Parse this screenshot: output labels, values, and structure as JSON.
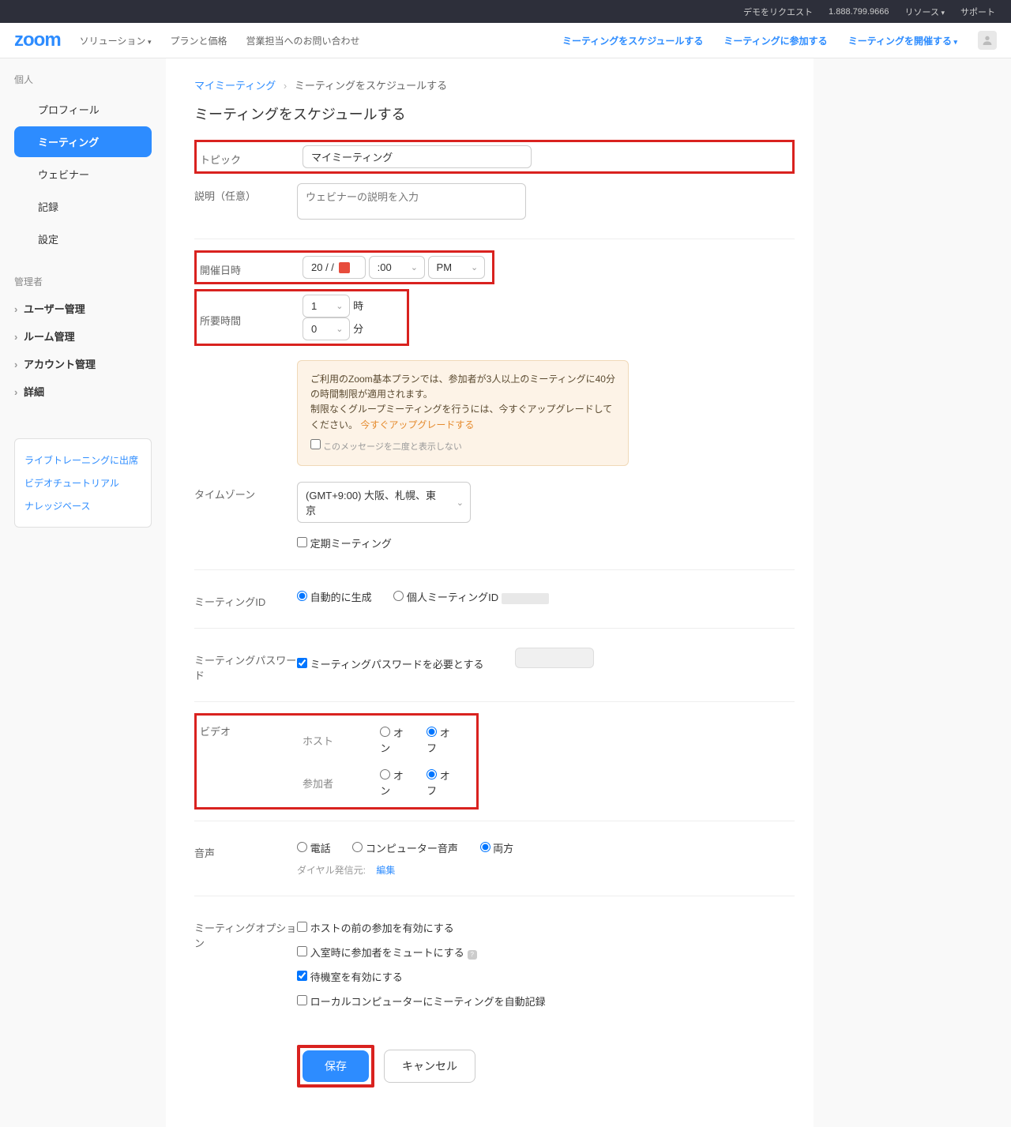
{
  "topbar": {
    "demo": "デモをリクエスト",
    "phone": "1.888.799.9666",
    "resources": "リソース",
    "support": "サポート"
  },
  "header": {
    "logo": "zoom",
    "nav": {
      "solutions": "ソリューション",
      "plans": "プランと価格",
      "contact": "営業担当へのお問い合わせ"
    },
    "right": {
      "schedule": "ミーティングをスケジュールする",
      "join": "ミーティングに参加する",
      "host": "ミーティングを開催する"
    }
  },
  "sidebar": {
    "personal_label": "個人",
    "items": {
      "profile": "プロフィール",
      "meeting": "ミーティング",
      "webinar": "ウェビナー",
      "record": "記録",
      "settings": "設定"
    },
    "admin_label": "管理者",
    "admin": {
      "user": "ユーザー管理",
      "room": "ルーム管理",
      "account": "アカウント管理",
      "detail": "詳細"
    },
    "help": {
      "live": "ライブトレーニングに出席",
      "video": "ビデオチュートリアル",
      "kb": "ナレッジベース"
    }
  },
  "breadcrumb": {
    "my_meetings": "マイミーティング",
    "current": "ミーティングをスケジュールする"
  },
  "page_title": "ミーティングをスケジュールする",
  "form": {
    "topic_label": "トピック",
    "topic_value": "マイミーティング",
    "desc_label": "説明（任意）",
    "desc_placeholder": "ウェビナーの説明を入力",
    "date_label": "開催日時",
    "date_value": "20    /    /",
    "time_value": ":00",
    "ampm": "PM",
    "duration_label": "所要時間",
    "dur_h": "1",
    "dur_h_unit": "時",
    "dur_m": "0",
    "dur_m_unit": "分",
    "notice_line1": "ご利用のZoom基本プランでは、参加者が3人以上のミーティングに40分の時間制限が適用されます。",
    "notice_line2": "制限なくグループミーティングを行うには、今すぐアップグレードしてください。",
    "notice_link": "今すぐアップグレードする",
    "notice_cb": "このメッセージを二度と表示しない",
    "tz_label": "タイムゾーン",
    "tz_value": "(GMT+9:00) 大阪、札幌、東京",
    "recurring": "定期ミーティング",
    "mid_label": "ミーティングID",
    "mid_auto": "自動的に生成",
    "mid_pmi": "個人ミーティングID",
    "pwd_label": "ミーティングパスワード",
    "pwd_cb": "ミーティングパスワードを必要とする",
    "video_label": "ビデオ",
    "video_host": "ホスト",
    "video_participant": "参加者",
    "on": "オン",
    "off": "オフ",
    "audio_label": "音声",
    "audio_phone": "電話",
    "audio_computer": "コンピューター音声",
    "audio_both": "両方",
    "dial_label": "ダイヤル発信元:",
    "dial_edit": "編集",
    "options_label": "ミーティングオプション",
    "opt_before": "ホストの前の参加を有効にする",
    "opt_mute": "入室時に参加者をミュートにする",
    "opt_wait": "待機室を有効にする",
    "opt_record": "ローカルコンピューターにミーティングを自動記録",
    "save": "保存",
    "cancel": "キャンセル"
  }
}
